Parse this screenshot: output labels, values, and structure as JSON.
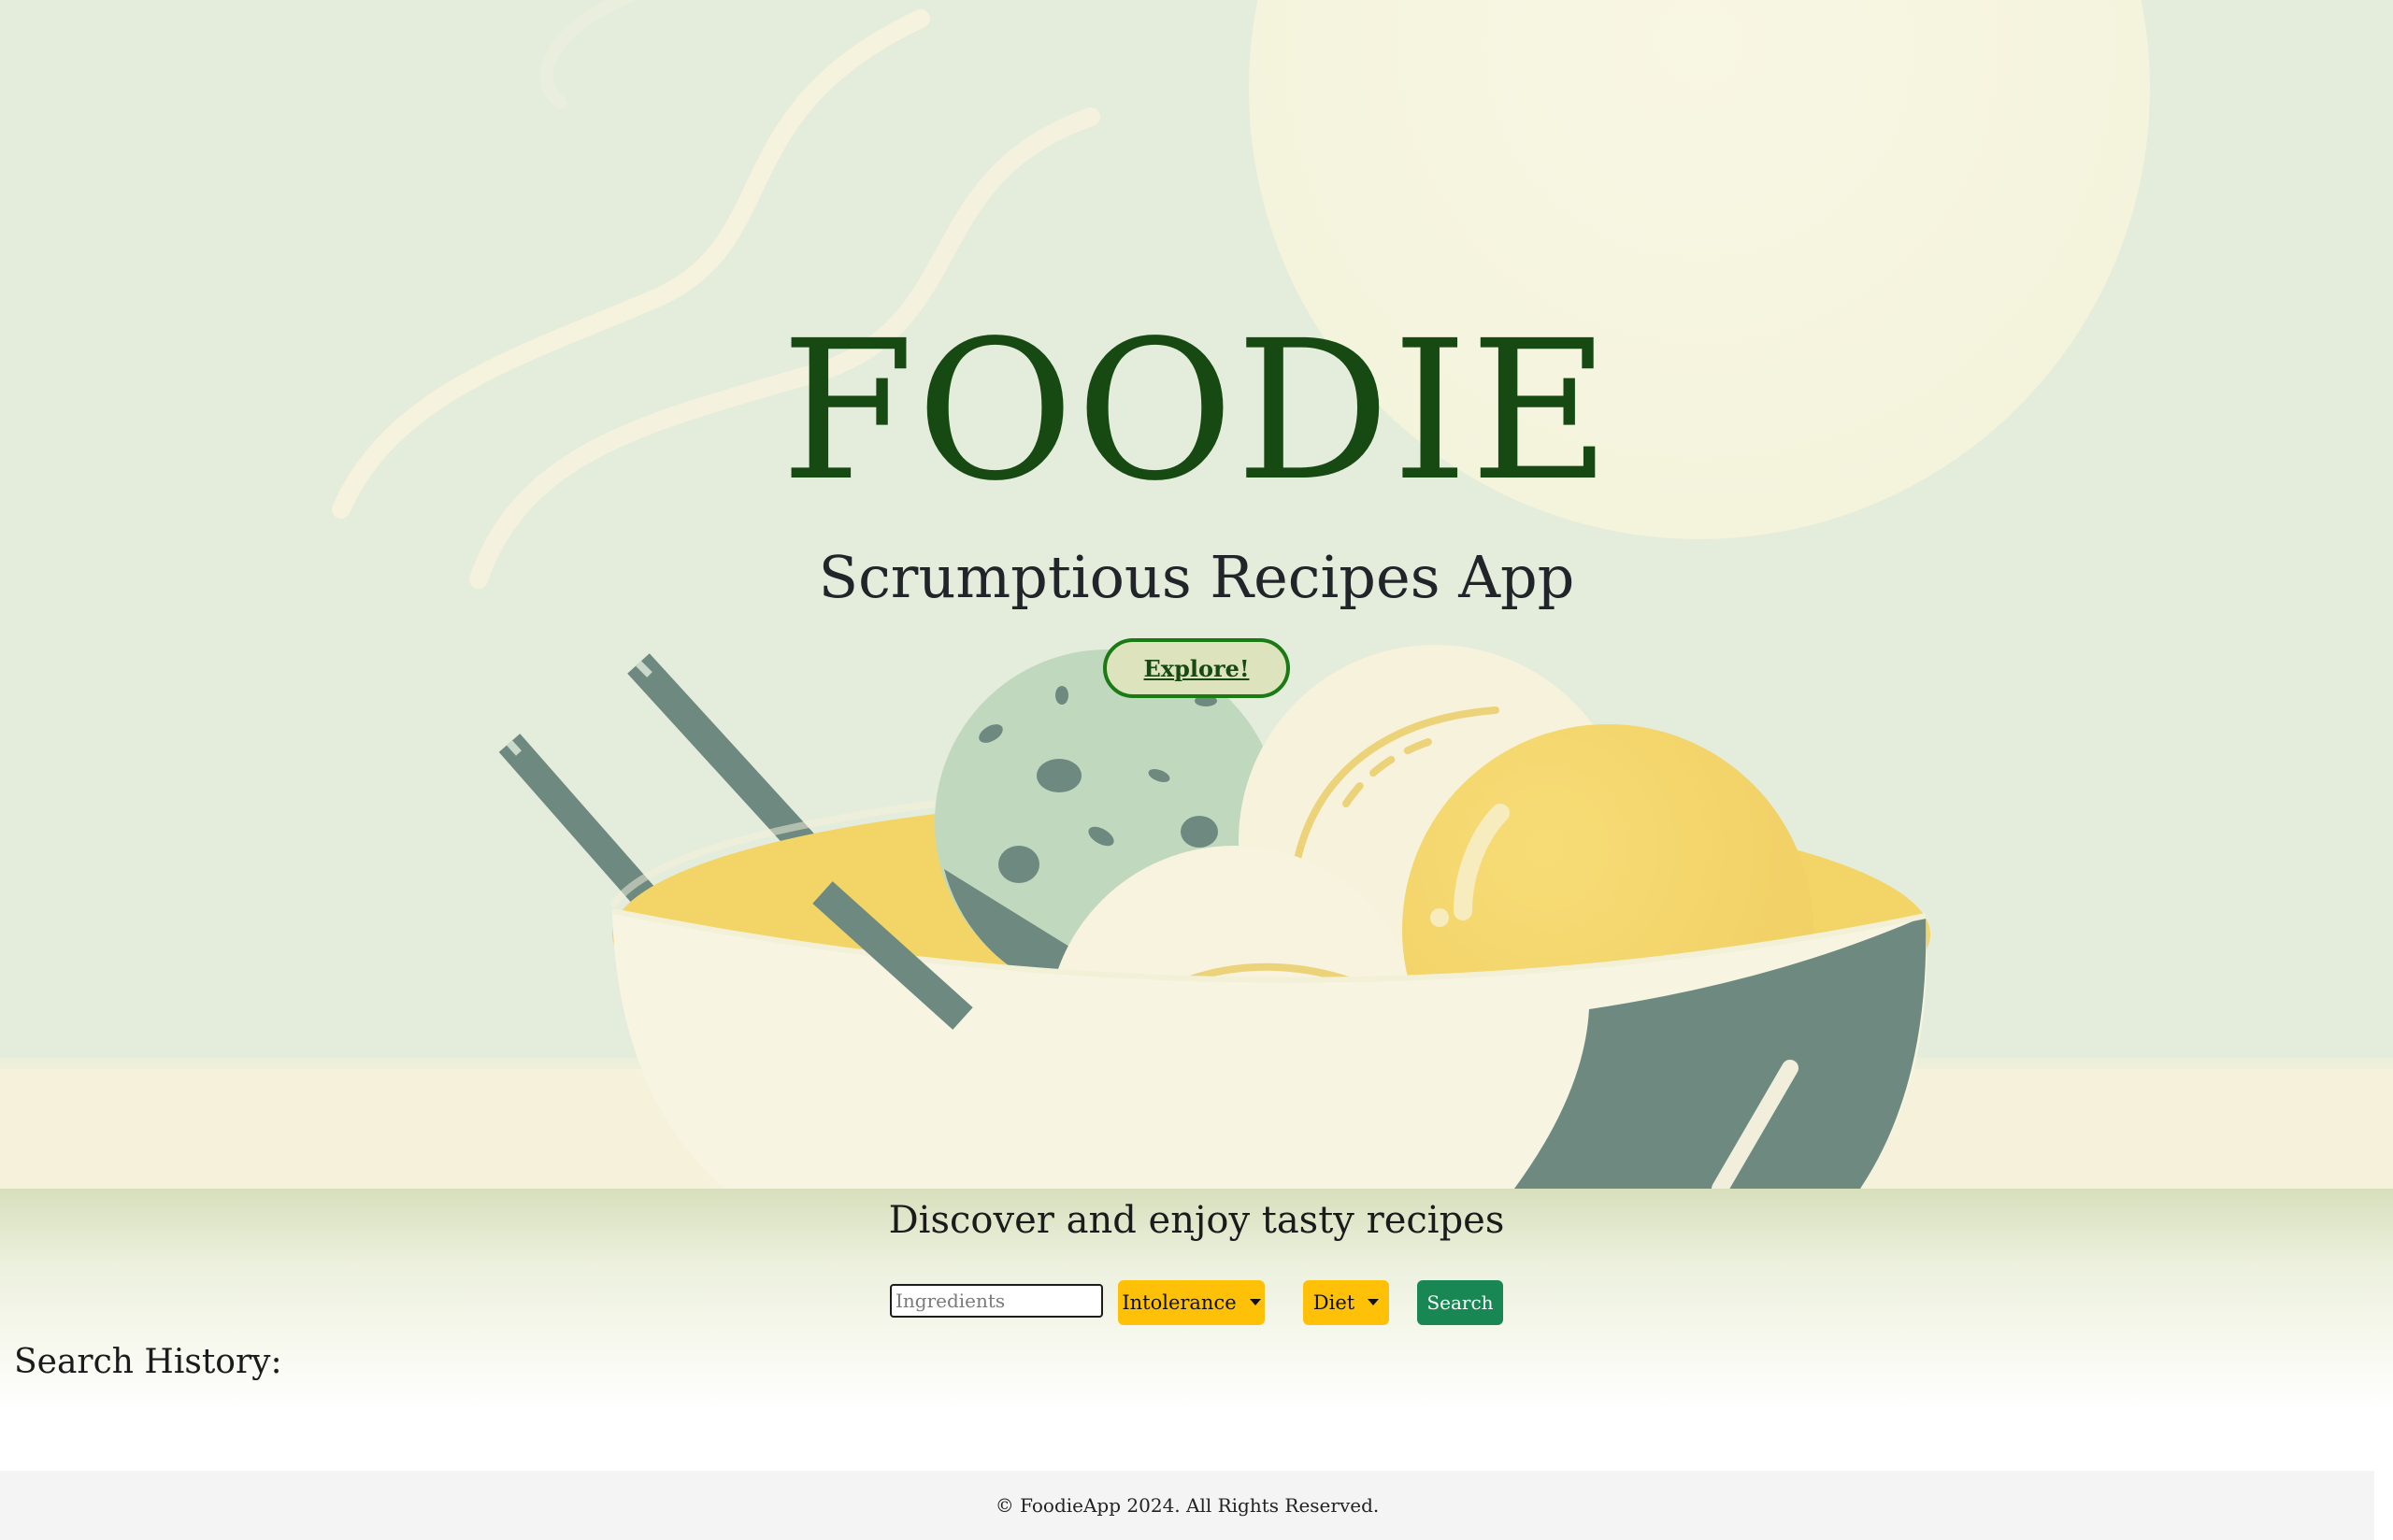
{
  "hero": {
    "title": "FOODIE",
    "subtitle": "Scrumptious Recipes App",
    "explore_label": "Explore!"
  },
  "search": {
    "tagline": "Discover and enjoy tasty recipes",
    "ingredients_placeholder": "Ingredients",
    "ingredients_value": "",
    "intolerance_label": "Intolerance",
    "diet_label": "Diet",
    "search_label": "Search"
  },
  "history": {
    "label": "Search History:"
  },
  "footer": {
    "copyright": "© FoodieApp 2024. All Rights Reserved."
  },
  "colors": {
    "title_green": "#164a12",
    "dropdown_yellow": "#ffc107",
    "search_green": "#198754"
  },
  "icons": {
    "dropdown_caret": "caret-down-icon"
  }
}
